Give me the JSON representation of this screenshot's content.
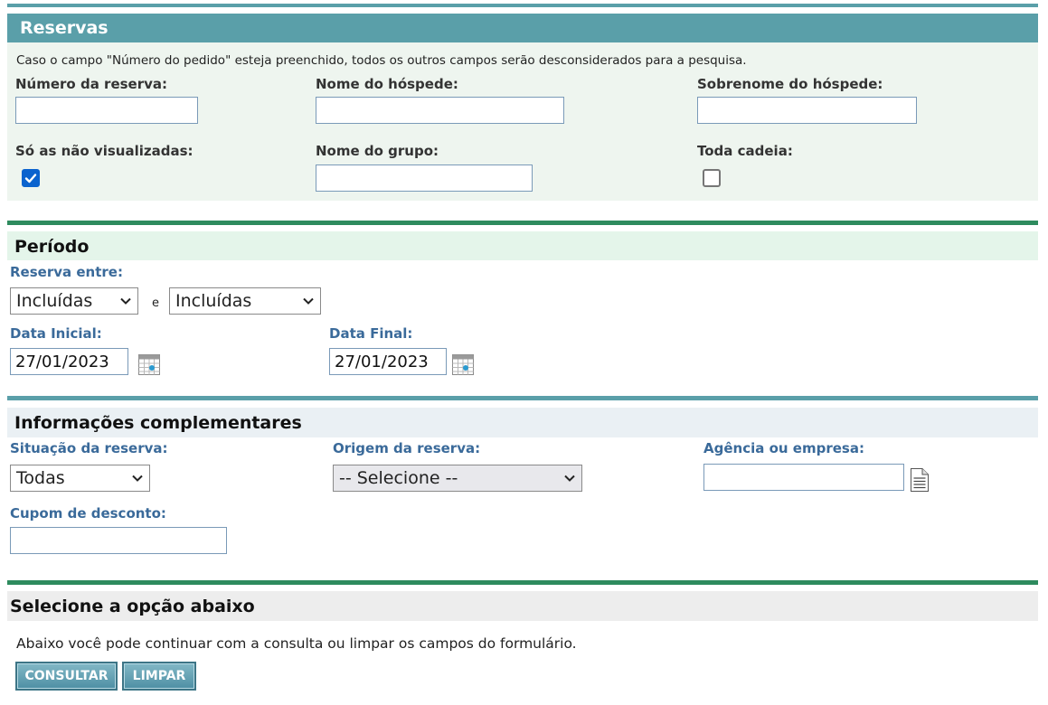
{
  "reservas": {
    "title": "Reservas",
    "notice": "Caso o campo \"Número do pedido\" esteja preenchido, todos os outros campos serão desconsiderados para a pesquisa.",
    "numero_label": "Número da reserva:",
    "numero_value": "",
    "nome_label": "Nome do hóspede:",
    "nome_value": "",
    "sobrenome_label": "Sobrenome do hóspede:",
    "sobrenome_value": "",
    "nao_visualizadas_label": "Só as não visualizadas:",
    "nao_visualizadas_checked": true,
    "grupo_label": "Nome do grupo:",
    "grupo_value": "",
    "toda_cadeia_label": "Toda cadeia:",
    "toda_cadeia_checked": false
  },
  "periodo": {
    "title": "Período",
    "reserva_entre_label": "Reserva entre:",
    "select1_value": "Incluídas",
    "conjunction": "e",
    "select2_value": "Incluídas",
    "data_inicial_label": "Data Inicial:",
    "data_inicial_value": "27/01/2023",
    "data_final_label": "Data Final:",
    "data_final_value": "27/01/2023"
  },
  "complementares": {
    "title": "Informações complementares",
    "situacao_label": "Situação da reserva:",
    "situacao_value": "Todas",
    "origem_label": "Origem da reserva:",
    "origem_value": "-- Selecione --",
    "agencia_label": "Agência ou empresa:",
    "agencia_value": "",
    "cupom_label": "Cupom de desconto:",
    "cupom_value": ""
  },
  "acoes": {
    "title": "Selecione a opção abaixo",
    "description": "Abaixo você pode continuar com a consulta ou limpar os campos do formulário.",
    "consultar_label": "CONSULTAR",
    "limpar_label": "LIMPAR"
  },
  "colors": {
    "header_teal": "#5a9fa9",
    "section_green": "#2e8b5e",
    "checkbox_blue": "#0b63ce"
  }
}
